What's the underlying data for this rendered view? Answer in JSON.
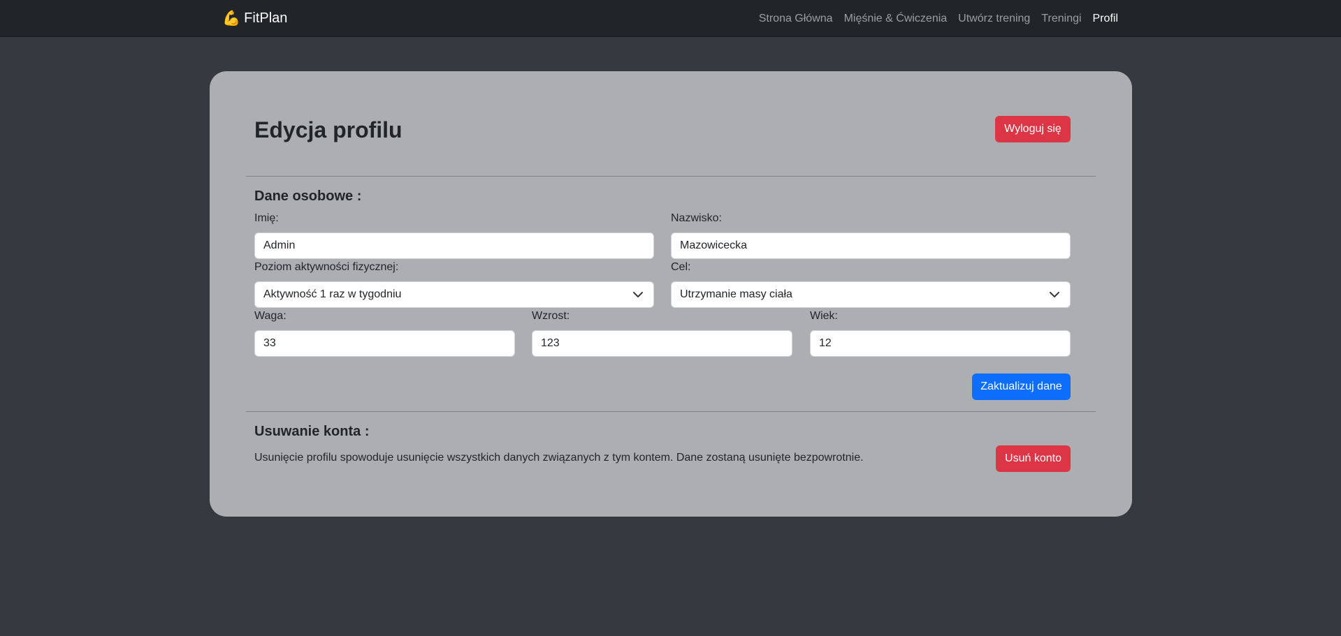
{
  "navbar": {
    "brand_icon": "💪",
    "brand": "FitPlan",
    "links": [
      {
        "label": "Strona Główna"
      },
      {
        "label": "Mięśnie & Ćwiczenia"
      },
      {
        "label": "Utwórz trening"
      },
      {
        "label": "Treningi"
      },
      {
        "label": "Profil"
      }
    ],
    "active_index": 4
  },
  "profile": {
    "title": "Edycja profilu",
    "logout_label": "Wyloguj się",
    "personal_section": "Dane osobowe :",
    "first_name": {
      "label": "Imię:",
      "value": "Admin"
    },
    "last_name": {
      "label": "Nazwisko:",
      "value": "Mazowicecka"
    },
    "activity": {
      "label": "Poziom aktywności fizycznej:",
      "value": "Aktywność 1 raz w tygodniu"
    },
    "goal": {
      "label": "Cel:",
      "value": "Utrzymanie masy ciała"
    },
    "weight": {
      "label": "Waga:",
      "value": "33"
    },
    "height": {
      "label": "Wzrost:",
      "value": "123"
    },
    "age": {
      "label": "Wiek:",
      "value": "12"
    },
    "update_label": "Zaktualizuj dane",
    "delete_section": "Usuwanie konta :",
    "delete_description": "Usunięcie profilu spowoduje usunięcie wszystkich danych związanych z tym kontem. Dane zostaną usunięte bezpowrotnie.",
    "delete_label": "Usuń konto"
  },
  "colors": {
    "background": "#343a40",
    "navbar": "#212529",
    "card": "#adaeb2",
    "danger": "#dc3545",
    "primary": "#0d6efd"
  }
}
